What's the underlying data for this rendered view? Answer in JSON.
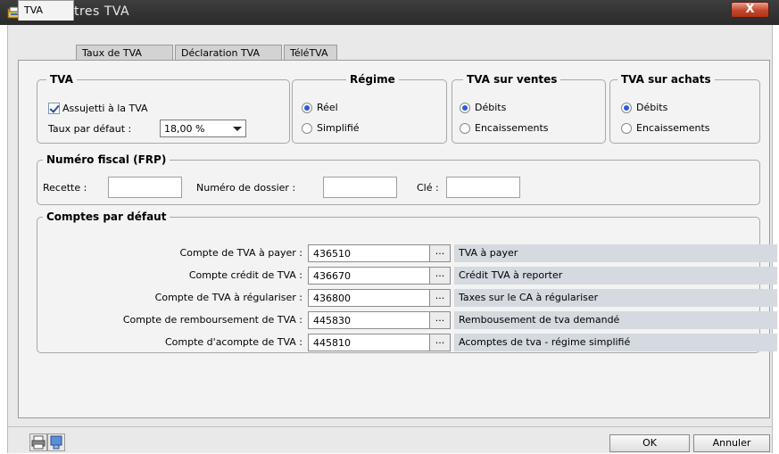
{
  "window": {
    "title": "Paramètres TVA",
    "close_glyph": "X"
  },
  "tabs": [
    {
      "label": "TVA",
      "active": true
    },
    {
      "label": "Taux de TVA",
      "active": false
    },
    {
      "label": "Déclaration TVA",
      "active": false
    },
    {
      "label": "TéléTVA",
      "active": false
    }
  ],
  "tva_group": {
    "legend": "TVA",
    "assujetti_label": "Assujetti à la TVA",
    "assujetti_checked": true,
    "taux_label": "Taux par défaut :",
    "taux_value": "18,00 %"
  },
  "regime_group": {
    "legend": "Régime",
    "options": [
      {
        "label": "Réel",
        "selected": true
      },
      {
        "label": "Simplifié",
        "selected": false
      }
    ]
  },
  "ventes_group": {
    "legend": "TVA sur ventes",
    "options": [
      {
        "label": "Débits",
        "selected": true
      },
      {
        "label": "Encaissements",
        "selected": false
      }
    ]
  },
  "achats_group": {
    "legend": "TVA sur achats",
    "options": [
      {
        "label": "Débits",
        "selected": true
      },
      {
        "label": "Encaissements",
        "selected": false
      }
    ]
  },
  "fiscal_group": {
    "legend": "Numéro fiscal (FRP)",
    "recette_label": "Recette :",
    "recette_value": "",
    "dossier_label": "Numéro de dossier :",
    "dossier_value": "",
    "cle_label": "Clé :",
    "cle_value": ""
  },
  "comptes_group": {
    "legend": "Comptes par défaut",
    "browse_label": "...",
    "rows": [
      {
        "label": "Compte de TVA à payer :",
        "account": "436510",
        "description": "TVA à payer"
      },
      {
        "label": "Compte crédit de TVA :",
        "account": "436670",
        "description": "Crédit TVA à reporter"
      },
      {
        "label": "Compte de TVA à régulariser :",
        "account": "436800",
        "description": "Taxes sur le CA à régulariser"
      },
      {
        "label": "Compte de remboursement de TVA :",
        "account": "445830",
        "description": "Rembousement de tva demandé"
      },
      {
        "label": "Compte d'acompte de TVA :",
        "account": "445810",
        "description": "Acomptes de tva - régime simplifié"
      }
    ]
  },
  "footer": {
    "ok_label": "OK",
    "cancel_label": "Annuler"
  },
  "colors": {
    "title_bar": "#2f2f2f",
    "close_button": "#c4452b",
    "radio_selected": "#2a5ad8",
    "description_bg": "#d4dae0"
  },
  "icons": {
    "app": "folder-settings-icon",
    "print": "printer-icon",
    "help": "help-icon"
  }
}
